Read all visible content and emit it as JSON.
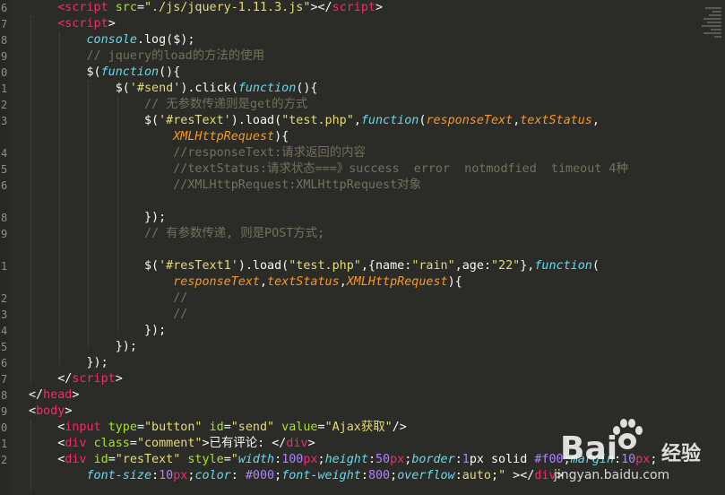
{
  "gutter_numbers": [
    "6",
    "7",
    "8",
    "9",
    "0",
    "1",
    "2",
    "3",
    "",
    "4",
    "5",
    "6",
    "",
    "8",
    "9",
    "",
    "1",
    "",
    "2",
    "3",
    "4",
    "5",
    "6",
    "7",
    "8",
    "9",
    "0",
    "1",
    "2",
    "",
    ""
  ],
  "lines": {
    "l6": [
      "    ",
      "<script ",
      "src",
      "=",
      "\"./js/jquery-1.11.3.js\"",
      "></",
      "script",
      ">"
    ],
    "l7": [
      "    ",
      "<script",
      ">"
    ],
    "l8": [
      "        ",
      "console",
      ".log($);"
    ],
    "l9": [
      "        ",
      "// jquery的load的方法的使用"
    ],
    "l10": [
      "        ",
      "$(",
      "function",
      "(){"
    ],
    "l11": [
      "            ",
      "$(",
      "'#send'",
      ").click(",
      "function",
      "(){"
    ],
    "l12": [
      "                ",
      "// 无参数传递则是get的方式"
    ],
    "l13": [
      "                ",
      "$(",
      "'#resText'",
      ").load(",
      "\"test.php\"",
      ",",
      "function",
      "(",
      "responseText",
      ",",
      "textStatus",
      ","
    ],
    "l13b": [
      "                    ",
      "XMLHttpRequest",
      "){"
    ],
    "l14": [
      "                    ",
      "//responseText:请求返回的内容"
    ],
    "l15": [
      "                    ",
      "//textStatus:请求状态===》success  error  notmodfied  timeout 4种"
    ],
    "l16": [
      "                    ",
      "//XMLHttpRequest:XMLHttpRequest对象"
    ],
    "l18": [
      "                ",
      "});"
    ],
    "l19": [
      "                ",
      "// 有参数传递, 则是POST方式;"
    ],
    "l21": [
      "                ",
      "$(",
      "'#resText1'",
      ").load(",
      "\"test.php\"",
      ",{name:",
      "\"rain\"",
      ",age:",
      "\"22\"",
      "},",
      "function",
      "("
    ],
    "l21b": [
      "                    ",
      "responseText",
      ",",
      "textStatus",
      ",",
      "XMLHttpRequest",
      "){"
    ],
    "l22": [
      "                    ",
      "//"
    ],
    "l23": [
      "                    ",
      "//"
    ],
    "l24": [
      "                ",
      "});"
    ],
    "l25": [
      "            ",
      "});"
    ],
    "l26": [
      "        ",
      "});"
    ],
    "l27": [
      "    ",
      "</",
      "script",
      ">"
    ],
    "l28": [
      "",
      "</",
      "head",
      ">"
    ],
    "l29": [
      "",
      "<",
      "body",
      ">"
    ],
    "l30": [
      "    ",
      "<",
      "input ",
      "type",
      "=",
      "\"button\"",
      " id",
      "=",
      "\"send\"",
      " value",
      "=",
      "\"Ajax获取\"",
      "/>"
    ],
    "l31": [
      "    ",
      "<",
      "div ",
      "class",
      "=",
      "\"comment\"",
      ">已有评论: </",
      "div",
      ">"
    ],
    "l32": [
      "    ",
      "<",
      "div ",
      "id",
      "=",
      "\"resText\"",
      " style",
      "=",
      "\"",
      "width",
      ":",
      "100",
      "px",
      ";",
      "height",
      ":",
      "50",
      "px",
      ";",
      "border",
      ":",
      "1",
      "px solid ",
      "#f00",
      ";",
      "margin",
      ":",
      "10",
      "px",
      ";"
    ],
    "l32b": [
      "        ",
      "font-size",
      ":",
      "10",
      "px",
      ";",
      "color",
      ":",
      " #000",
      ";",
      "font-weight",
      ":",
      "800",
      ";",
      "overflow",
      ":",
      "auto",
      ";",
      "\"",
      " ></",
      "div",
      ">"
    ]
  },
  "watermark": {
    "brand_left": "Bai",
    "brand_right": "经验",
    "url": "jingyan.baidu.com"
  },
  "colors": {
    "background": "#2b2c27",
    "tag": "#f92672",
    "attribute": "#a6e22e",
    "string": "#e6db74",
    "keyword_function": "#66d9ef",
    "parameter": "#fd971f",
    "comment": "#75715e",
    "number": "#ae81ff"
  }
}
